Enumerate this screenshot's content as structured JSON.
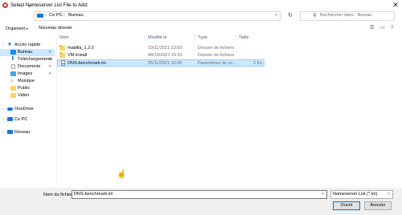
{
  "window": {
    "title": "Select Nameserver List File to Add:",
    "close_glyph": "✕",
    "icon": "app-icon"
  },
  "nav": {
    "back_glyph": "←",
    "forward_glyph": "→",
    "up_glyph": "↑",
    "recent_glyph": "˅",
    "breadcrumb": [
      "Ce PC",
      "Bureau"
    ],
    "separator_glyph": "›",
    "dropdown_glyph": "˅",
    "refresh_glyph": "↻",
    "search_glyph": "⚲",
    "search_placeholder": "Rechercher dans : Bureau"
  },
  "toolbar": {
    "organize_label": "Organiser",
    "new_folder_label": "Nouveau dossier",
    "caret_glyph": "▾",
    "view_glyph": "☰",
    "pane_glyph": "▭",
    "help_glyph": "?"
  },
  "sidebar": {
    "chevron_glyph": "›",
    "pin_glyph": "✦",
    "items": [
      {
        "label": "Accès rapide",
        "icon": "star-icon",
        "color": "#2b78e4"
      },
      {
        "label": "Bureau",
        "icon": "desktop-icon",
        "color": "#1e88e5"
      },
      {
        "label": "Téléchargements",
        "icon": "download-icon",
        "color": "#1e88e5"
      },
      {
        "label": "Documents",
        "icon": "documents-icon",
        "color": "#9e9e9e"
      },
      {
        "label": "Images",
        "icon": "pictures-icon",
        "color": "#42a5f5"
      },
      {
        "label": "Musique",
        "icon": "music-icon",
        "color": "#e65100"
      },
      {
        "label": "Public",
        "icon": "folder-icon",
        "color": "#f8d56b"
      },
      {
        "label": "Vidéo",
        "icon": "folder-icon",
        "color": "#f8d56b"
      },
      {
        "label": "OneDrive",
        "icon": "cloud-icon",
        "color": "#1976d2"
      },
      {
        "label": "Ce PC",
        "icon": "computer-icon",
        "color": "#1976d2"
      },
      {
        "label": "Réseau",
        "icon": "network-icon",
        "color": "#1976d2"
      }
    ]
  },
  "columns": {
    "name": "Nom",
    "modified": "Modifié le",
    "type": "Type",
    "size": "Taille"
  },
  "files": [
    {
      "name": "mabilla_1.2.0",
      "modified": "19/11/2021 23:59",
      "type": "Dossier de fichiers",
      "size": "",
      "kind": "folder"
    },
    {
      "name": "VM-install",
      "modified": "08/10/2021 15:41",
      "type": "Dossier de fichiers",
      "size": "",
      "kind": "folder"
    },
    {
      "name": "DNS-benchmark.ini",
      "modified": "25/11/2021 15:42",
      "type": "Paramètres de co...",
      "size": "2 Ko",
      "kind": "file"
    }
  ],
  "footer": {
    "filename_label": "Nom du fichier :",
    "filename_value": "DNS-benchmark.ini",
    "filetype_value": "Nameserver List (*.ini)",
    "dropdown_glyph": "˅",
    "open_label": "Ouvrir",
    "cancel_label": "Annuler"
  },
  "cursor_glyph": "☝",
  "colors": {
    "selection": "#cce8ff",
    "accent": "#0078d7"
  }
}
